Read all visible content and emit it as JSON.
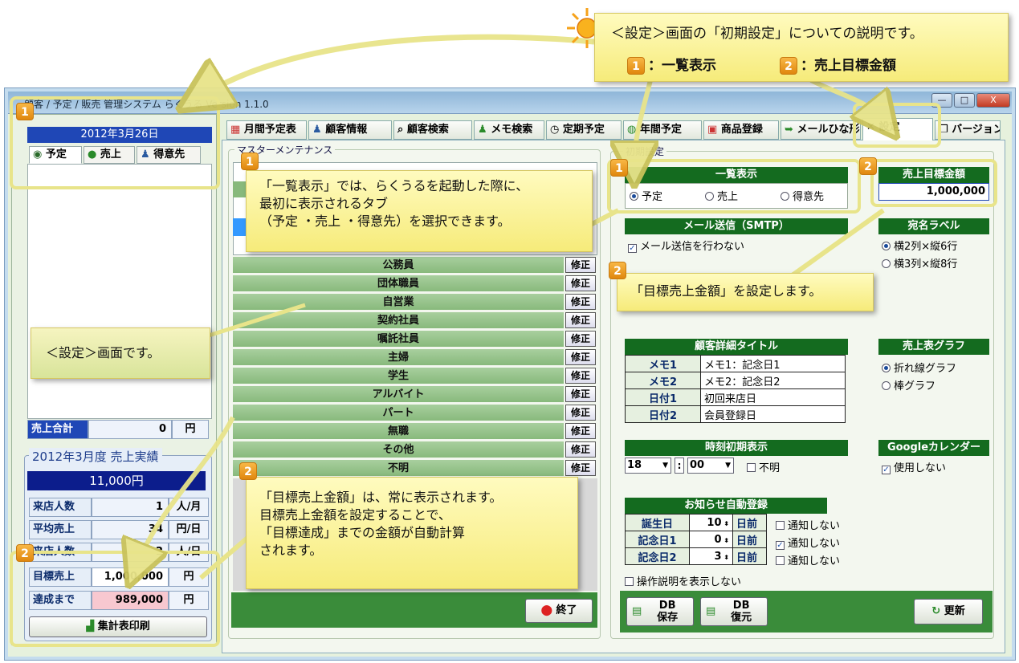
{
  "window": {
    "title": "顧客 / 予定 / 販売 管理システム らくうる  Version 1.1.0",
    "min": "—",
    "max": "□",
    "close": "X"
  },
  "left": {
    "date": "2012年3月26日",
    "tabs": [
      "予定",
      "売上",
      "得意先"
    ],
    "sales_total_label": "売上合計",
    "sales_total_value": "0",
    "sales_total_unit": "円",
    "perf_title": "2012年3月度  売上実績",
    "perf_amount": "11,000円",
    "rows": [
      {
        "label": "来店人数",
        "value": "1",
        "unit": "人/月"
      },
      {
        "label": "平均売上",
        "value": "34",
        "unit": "円/日"
      },
      {
        "label": "来店人数",
        "value": "2",
        "unit": "人/日"
      },
      {
        "label": "目標売上",
        "value": "1,000,000",
        "unit": "円"
      },
      {
        "label": "達成まで",
        "value": "989,000",
        "unit": "円"
      }
    ],
    "print_button": "集計表印刷"
  },
  "tabs": [
    "月間予定表",
    "顧客情報",
    "顧客検索",
    "メモ検索",
    "定期予定",
    "年間予定",
    "商品登録",
    "メールひな形",
    "設定",
    "バージョン"
  ],
  "master": {
    "group_label": "マスターメンテナンス",
    "items": [
      "公務員",
      "団体職員",
      "自営業",
      "契約社員",
      "嘱託社員",
      "主婦",
      "学生",
      "アルバイト",
      "パート",
      "無職",
      "その他",
      "不明"
    ],
    "edit_label": "修正",
    "exit_button": "終了"
  },
  "settings": {
    "group_label": "初期設定",
    "list_display": {
      "head": "一覧表示",
      "options": [
        "予定",
        "売上",
        "得意先"
      ],
      "selected": 0
    },
    "sales_target": {
      "head": "売上目標金額",
      "value": "1,000,000"
    },
    "mail": {
      "head": "メール送信（SMTP）",
      "check": "メール送信を行わない"
    },
    "address_label": {
      "head": "宛名ラベル",
      "options": [
        "横2列×縦6行",
        "横3列×縦8行"
      ],
      "selected": 0
    },
    "customer_title": {
      "head": "顧客詳細タイトル",
      "rows": [
        {
          "label": "メモ1",
          "value": "メモ1：記念日1"
        },
        {
          "label": "メモ2",
          "value": "メモ2：記念日2"
        },
        {
          "label": "日付1",
          "value": "初回来店日"
        },
        {
          "label": "日付2",
          "value": "会員登録日"
        }
      ]
    },
    "sales_graph": {
      "head": "売上表グラフ",
      "options": [
        "折れ線グラフ",
        "棒グラフ"
      ],
      "selected": 0
    },
    "time_init": {
      "head": "時刻初期表示",
      "hour": "18",
      "minute": "00",
      "unknown": "不明"
    },
    "google": {
      "head": "Googleカレンダー",
      "check": "使用しない"
    },
    "notice": {
      "head": "お知らせ自動登録",
      "rows": [
        {
          "label": "誕生日",
          "days": "10",
          "suffix": "日前",
          "check": "通知しない",
          "checked": false
        },
        {
          "label": "記念日1",
          "days": "0",
          "suffix": "日前",
          "check": "通知しない",
          "checked": true
        },
        {
          "label": "記念日2",
          "days": "3",
          "suffix": "日前",
          "check": "通知しない",
          "checked": false
        }
      ]
    },
    "hide_help": "操作説明を表示しない",
    "db_save": "DB\n保存",
    "db_restore": "DB\n復元",
    "update": "更新"
  },
  "callouts": {
    "top_title": "＜設定＞画面の「初期設定」についての説明です。",
    "top_title_bold": "初期設定",
    "top_item1": "：一覧表示",
    "top_item2": "：売上目標金額",
    "c1": "「一覧表示」では、らくうるを起動した際に、最初に表示されるタブ（予定 ・売上 ・得意先）を選択できます。",
    "c1_line1": "「一覧表示」では、らくうるを起動した際に、",
    "c1_line2": "最初に表示されるタブ",
    "c1_line3": "（予定 ・売上 ・得意先）を選択できます。",
    "c2": "「目標売上金額」を設定します。",
    "c3": "＜設定＞画面です。",
    "c4_line1": "「目標売上金額」は、常に表示されます。",
    "c4_line2": "目標売上金額を設定することで、",
    "c4_line3": "「目標達成」までの金額が自動計算",
    "c4_line4": "されます。",
    "n1": "1",
    "n2": "2"
  },
  "colors": {
    "accent_green": "#146b1f",
    "accent_blue": "#1f47b6",
    "note_yellow": "#fff6a0",
    "highlight": "#e8e48a"
  }
}
